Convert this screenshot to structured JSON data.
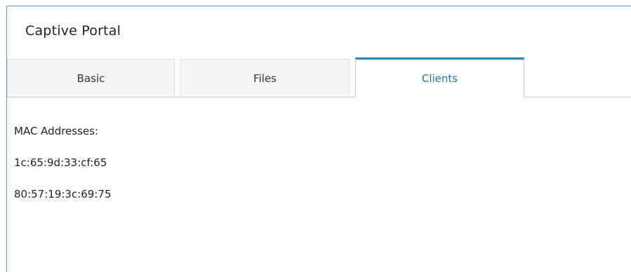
{
  "panel": {
    "title": "Captive Portal"
  },
  "tabs": [
    {
      "label": "Basic",
      "active": false
    },
    {
      "label": "Files",
      "active": false
    },
    {
      "label": "Clients",
      "active": true
    }
  ],
  "clients": {
    "label": "MAC Addresses:",
    "mac_addresses": [
      "1c:65:9d:33:cf:65",
      "80:57:19:3c:69:75"
    ]
  },
  "colors": {
    "accent": "#1e88c8",
    "active_tab_text": "#2273b0",
    "panel_border": "#5b8fd8",
    "inactive_tab_bg": "#f3f5f7"
  }
}
